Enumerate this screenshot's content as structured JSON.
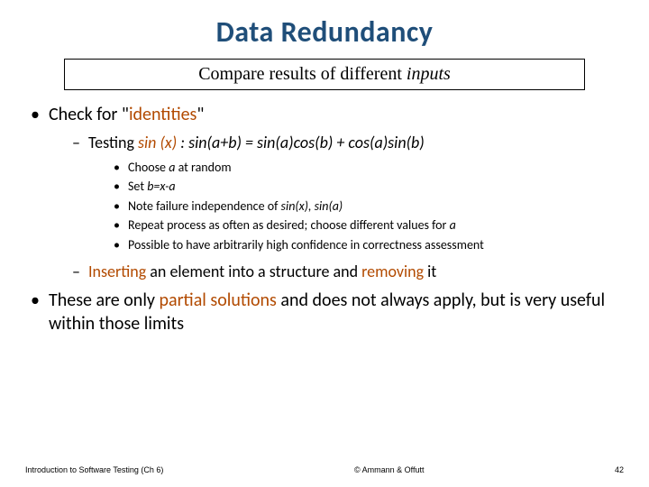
{
  "title": "Data Redundancy",
  "subtitle": {
    "pre": "Compare results of different ",
    "inputs": "inputs"
  },
  "b1": {
    "identities": {
      "pre": "Check for \"",
      "orange": "identities",
      "post": "\""
    },
    "testing": {
      "pre": "Testing ",
      "sin": "sin (x)",
      "post": " : sin(a+b) = sin(a)cos(b) + cos(a)sin(b)"
    },
    "l3": {
      "i1": {
        "pre": "Choose ",
        "a": "a",
        "post": " at random"
      },
      "i2": {
        "pre": "Set ",
        "bx": "b=x-a"
      },
      "i3": {
        "pre": "Note failure independence of ",
        "sx": "sin(x), sin(a)"
      },
      "i4": {
        "pre": "Repeat process as often as desired; choose different values for ",
        "a": "a"
      },
      "i5": "Possible to have arbitrarily high confidence in correctness assessment"
    },
    "ins_rem": {
      "ins": "Inserting",
      "mid": " an element into a structure and ",
      "rem": "removing",
      "post": " it"
    }
  },
  "b2": {
    "pre": "These are only ",
    "partial": "partial solutions",
    "post": " and does not always apply, but is very useful within those limits"
  },
  "footer": {
    "left": "Introduction to Software Testing (Ch 6)",
    "center": "© Ammann & Offutt",
    "right": "42"
  }
}
